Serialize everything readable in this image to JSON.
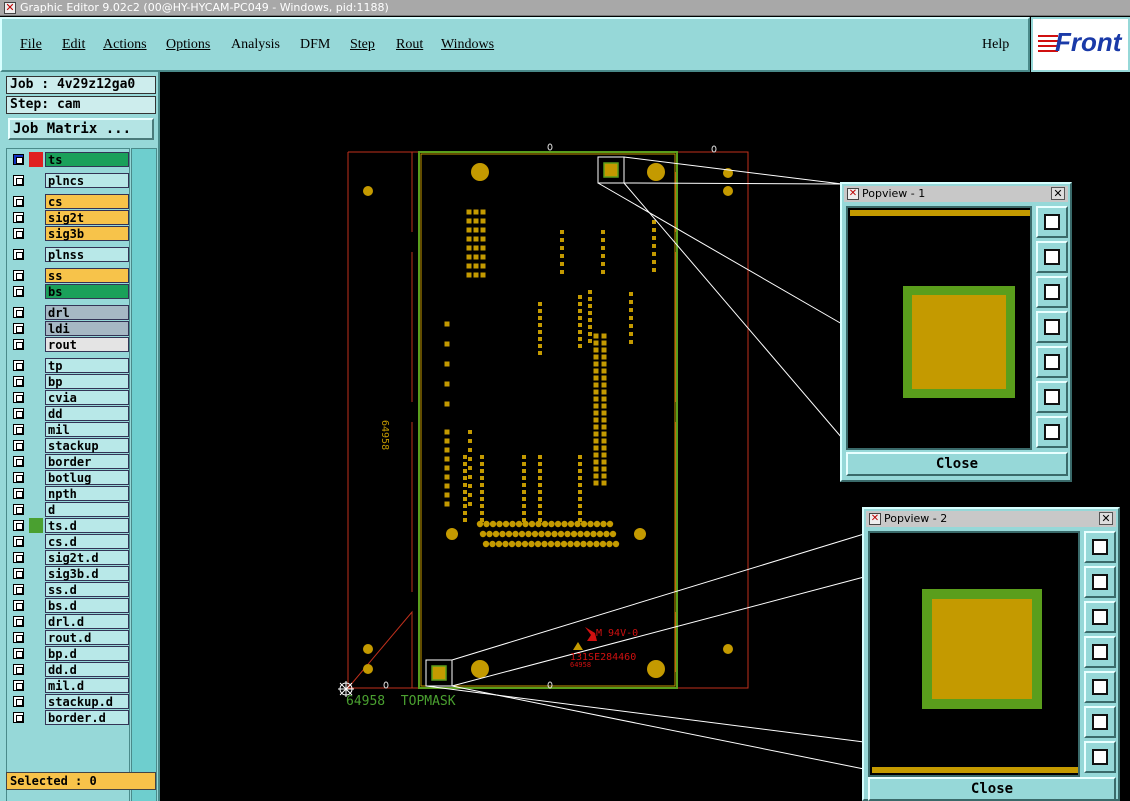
{
  "window": {
    "title": "Graphic Editor 9.02c2 (00@HY-HYCAM-PC049 - Windows, pid:1188)"
  },
  "menu": [
    "File",
    "Edit",
    "Actions",
    "Options",
    "Analysis",
    "DFM",
    "Step",
    "Rout",
    "Windows"
  ],
  "menu_help": "Help",
  "logo": {
    "text": "Front"
  },
  "job": {
    "label": "Job : 4v29z12ga0",
    "step": "Step: cam",
    "matrix_button": "Job Matrix ..."
  },
  "layers": [
    {
      "name": "ts",
      "color": "#1aa05a",
      "active": true
    },
    {
      "name": "plncs",
      "color": "#b8e8e8"
    },
    {
      "name": "cs",
      "color": "#f7c34a"
    },
    {
      "name": "sig2t",
      "color": "#f7c34a"
    },
    {
      "name": "sig3b",
      "color": "#f7c34a"
    },
    {
      "name": "plnss",
      "color": "#b8e8e8"
    },
    {
      "name": "ss",
      "color": "#f7c34a"
    },
    {
      "name": "bs",
      "color": "#1aa05a"
    },
    {
      "name": "drl",
      "color": "#a6b8c4"
    },
    {
      "name": "ldi",
      "color": "#a6b8c4"
    },
    {
      "name": "rout",
      "color": "#e4e4e4"
    },
    {
      "name": "tp",
      "color": "#b8e8e8"
    },
    {
      "name": "bp",
      "color": "#b8e8e8"
    },
    {
      "name": "cvia",
      "color": "#b8e8e8"
    },
    {
      "name": "dd",
      "color": "#b8e8e8"
    },
    {
      "name": "mil",
      "color": "#b8e8e8"
    },
    {
      "name": "stackup",
      "color": "#b8e8e8"
    },
    {
      "name": "border",
      "color": "#b8e8e8"
    },
    {
      "name": "botlug",
      "color": "#b8e8e8"
    },
    {
      "name": "npth",
      "color": "#b8e8e8"
    },
    {
      "name": "d",
      "color": "#b8e8e8"
    },
    {
      "name": "ts.d",
      "color": "#b8e8e8",
      "marker": "#4aa030"
    },
    {
      "name": "cs.d",
      "color": "#b8e8e8"
    },
    {
      "name": "sig2t.d",
      "color": "#b8e8e8"
    },
    {
      "name": "sig3b.d",
      "color": "#b8e8e8"
    },
    {
      "name": "ss.d",
      "color": "#b8e8e8"
    },
    {
      "name": "bs.d",
      "color": "#b8e8e8"
    },
    {
      "name": "drl.d",
      "color": "#b8e8e8"
    },
    {
      "name": "rout.d",
      "color": "#b8e8e8"
    },
    {
      "name": "bp.d",
      "color": "#b8e8e8"
    },
    {
      "name": "dd.d",
      "color": "#b8e8e8"
    },
    {
      "name": "mil.d",
      "color": "#b8e8e8"
    },
    {
      "name": "stackup.d",
      "color": "#b8e8e8"
    },
    {
      "name": "border.d",
      "color": "#b8e8e8"
    }
  ],
  "selected": "Selected : 0",
  "board": {
    "label_left": "64958",
    "label_bottom": "64958  TOPMASK",
    "red_text_1": "M 94V-0",
    "red_text_2": "131SE284460",
    "small_text": "64958"
  },
  "popviews": [
    {
      "title": "Popview - 1",
      "close": "Close"
    },
    {
      "title": "Popview - 2",
      "close": "Close"
    }
  ],
  "colors": {
    "pad": "#c49a00",
    "mask": "#5a9e1c",
    "outline": "#c0301c",
    "panel": "#96d8d8"
  }
}
